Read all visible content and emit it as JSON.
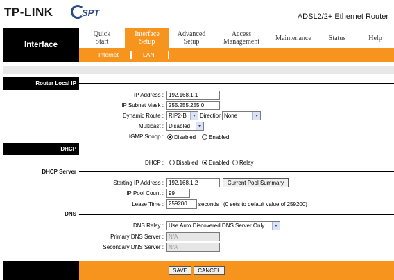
{
  "brand": {
    "logo": "TP-LINK",
    "partner_logo": "SPT",
    "product": "ADSL2/2+ Ethernet Router"
  },
  "nav": {
    "section": "Interface",
    "tabs": [
      {
        "label": "Quick\nStart"
      },
      {
        "label": "Interface\nSetup"
      },
      {
        "label": "Advanced\nSetup"
      },
      {
        "label": "Access\nManagement"
      },
      {
        "label": "Maintenance"
      },
      {
        "label": "Status"
      },
      {
        "label": "Help"
      }
    ],
    "subtabs": [
      {
        "label": "Internet"
      },
      {
        "label": "LAN"
      }
    ]
  },
  "sections": {
    "router_local_ip": "Router Local IP",
    "dhcp": "DHCP",
    "dhcp_server": "DHCP Server",
    "dns": "DNS"
  },
  "router": {
    "ip_label": "IP Address :",
    "ip_value": "192.168.1.1",
    "mask_label": "IP Subnet Mask :",
    "mask_value": "255.255.255.0",
    "dynamic_route_label": "Dynamic Route :",
    "dynamic_route_value": "RIP2-B",
    "direction_label": "Direction",
    "direction_value": "None",
    "multicast_label": "Multicast :",
    "multicast_value": "Disabled",
    "igmp_label": "IGMP Snoop :",
    "igmp_options": [
      "Disabled",
      "Enabled"
    ]
  },
  "dhcp": {
    "label": "DHCP :",
    "options": [
      "Disabled",
      "Enabled",
      "Relay"
    ]
  },
  "dhcp_server": {
    "start_ip_label": "Starting IP Address :",
    "start_ip_value": "192.168.1.2",
    "pool_summary_button": "Current Pool Summary",
    "pool_count_label": "IP Pool Count :",
    "pool_count_value": "99",
    "lease_label": "Lease Time :",
    "lease_value": "259200",
    "lease_unit": "seconds",
    "lease_hint": "(0 sets to default value of 259200)"
  },
  "dns": {
    "relay_label": "DNS Relay :",
    "relay_value": "Use Auto Discovered DNS Server Only",
    "primary_label": "Primary DNS Server :",
    "primary_value": "N/A",
    "secondary_label": "Secondary DNS Server :",
    "secondary_value": "N/A"
  },
  "buttons": {
    "save": "SAVE",
    "cancel": "CANCEL"
  },
  "colors": {
    "accent": "#f7941d",
    "dark": "#000000",
    "brand_blue": "#2a4a86"
  }
}
